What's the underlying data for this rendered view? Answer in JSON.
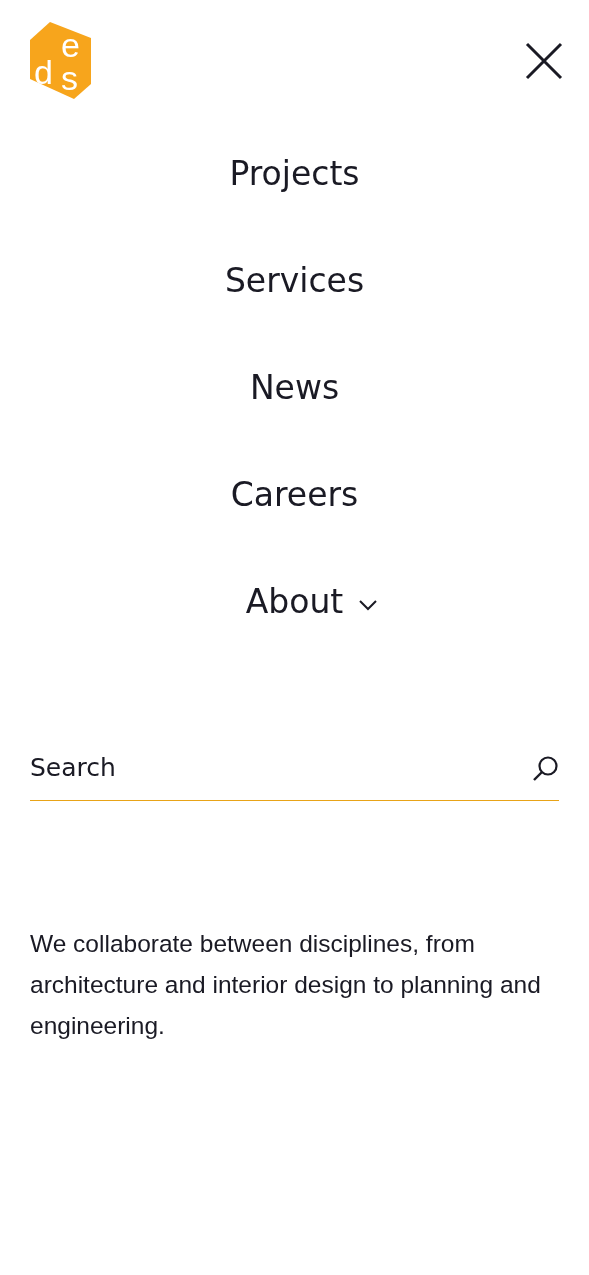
{
  "logo": {
    "text": "des"
  },
  "nav": [
    {
      "label": "Projects",
      "expandable": false
    },
    {
      "label": "Services",
      "expandable": false
    },
    {
      "label": "News",
      "expandable": false
    },
    {
      "label": "Careers",
      "expandable": false
    },
    {
      "label": "About",
      "expandable": true
    }
  ],
  "search": {
    "placeholder": "Search"
  },
  "tagline": "We collaborate between disciplines, from architecture and interior design to planning and engineering."
}
